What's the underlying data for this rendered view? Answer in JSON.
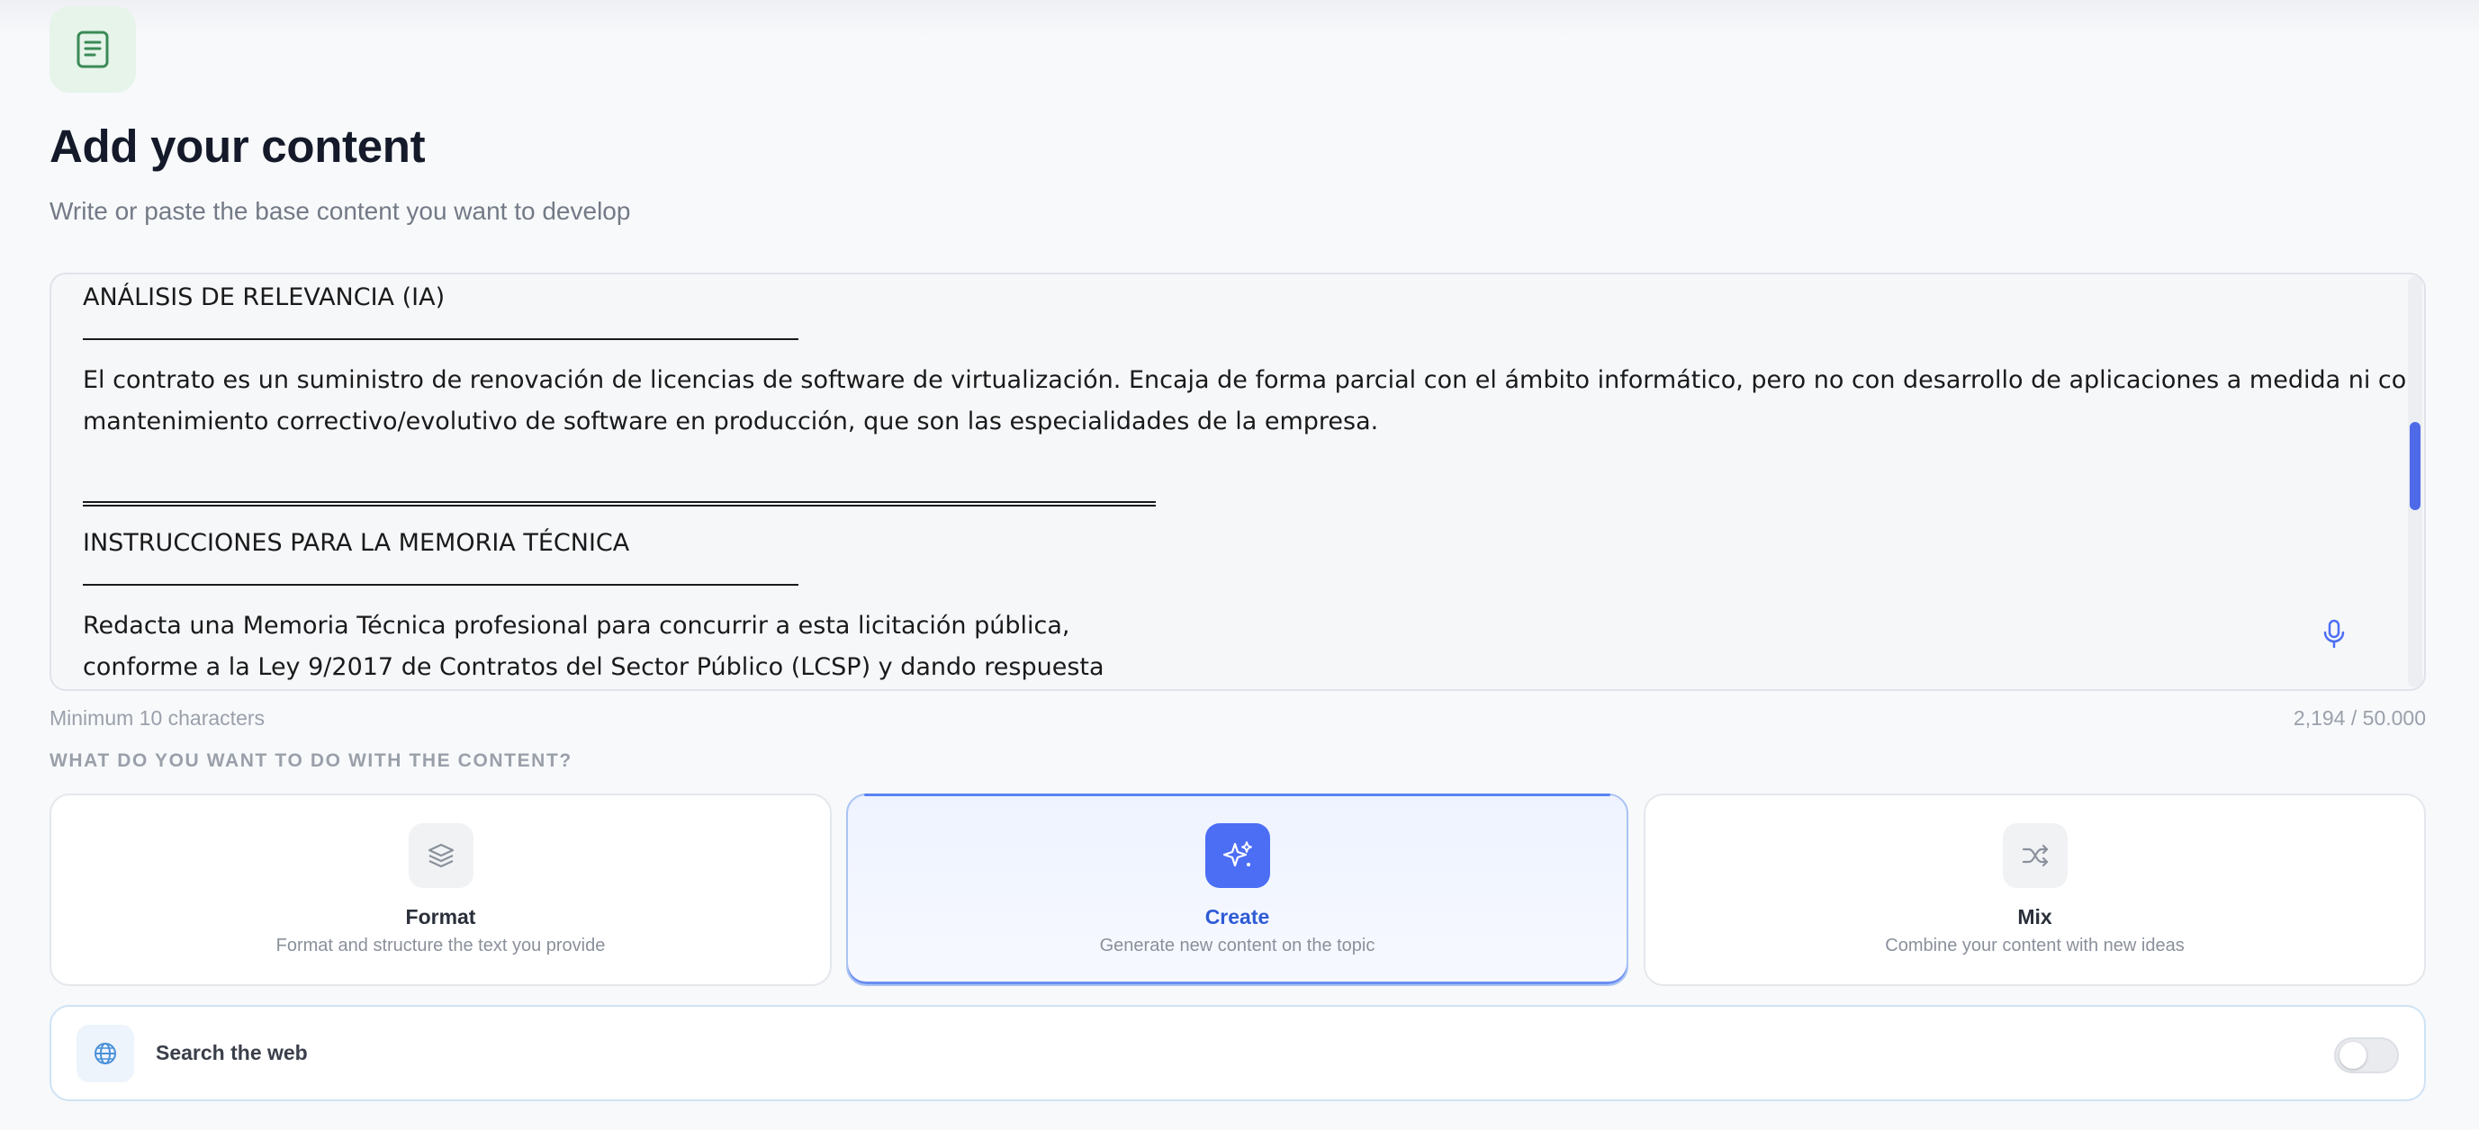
{
  "header": {
    "icon": "document-icon",
    "title": "Add your content",
    "subtitle": "Write or paste the base content you want to develop"
  },
  "editor": {
    "lines": [
      "ANÁLISIS DE RELEVANCIA (IA)",
      "El contrato es un suministro de renovación de licencias de software de virtualización. Encaja de forma parcial con el ámbito informático, pero no con desarrollo de aplicaciones a medida ni con",
      "mantenimiento correctivo/evolutivo de software en producción, que son las especialidades de la empresa.",
      "INSTRUCCIONES PARA LA MEMORIA TÉCNICA",
      "Redacta una Memoria Técnica profesional para concurrir a esta licitación pública,",
      "conforme a la Ley 9/2017 de Contratos del Sector Público (LCSP) y dando respuesta"
    ],
    "mic_icon": "microphone-icon",
    "min_hint": "Minimum 10 characters",
    "char_count": "2,194 / 50.000"
  },
  "modes": {
    "label": "WHAT DO YOU WANT TO DO WITH THE CONTENT?",
    "selected": "Create",
    "items": [
      {
        "title": "Format",
        "description": "Format and structure the text you provide",
        "icon": "layers-icon"
      },
      {
        "title": "Create",
        "description": "Generate new content on the topic",
        "icon": "sparkles-icon"
      },
      {
        "title": "Mix",
        "description": "Combine your content with new ideas",
        "icon": "shuffle-icon"
      }
    ]
  },
  "web_search": {
    "label": "Search the web",
    "icon": "globe-icon",
    "enabled": false
  },
  "colors": {
    "accent": "#4c6ef5",
    "badge_green": "#e6f4ea",
    "icon_green": "#3a8a55"
  }
}
